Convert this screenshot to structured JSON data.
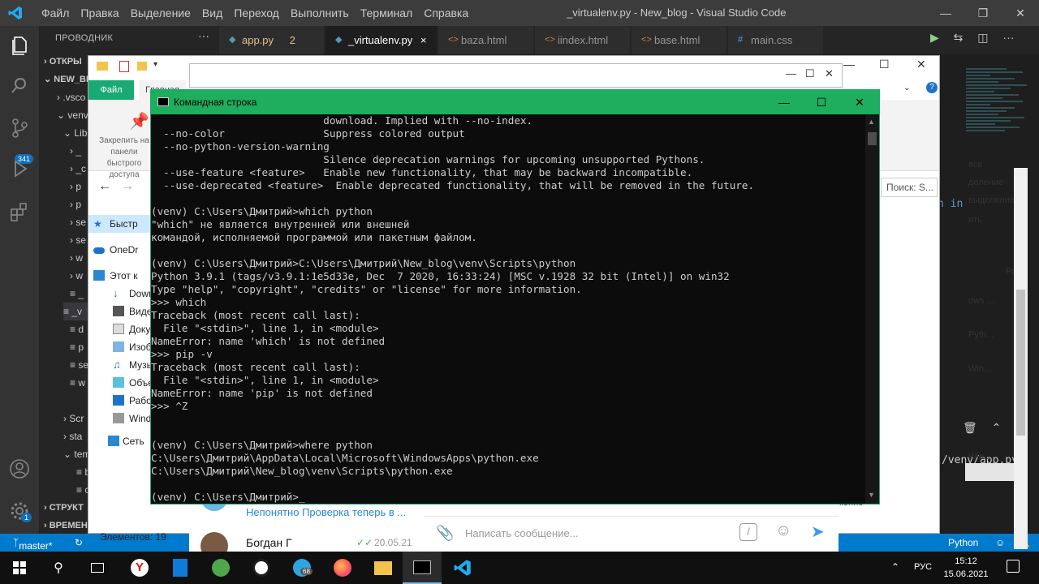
{
  "vscode": {
    "menu": [
      "Файл",
      "Правка",
      "Выделение",
      "Вид",
      "Переход",
      "Выполнить",
      "Терминал",
      "Справка"
    ],
    "window_title": "_virtualenv.py - New_blog - Visual Studio Code",
    "sidebar": {
      "header": "ПРОВОДНИК",
      "more": "···",
      "sections": [
        "ОТКРЫ",
        "NEW_BL"
      ],
      "items": [
        ".vsco",
        "venv",
        "Lib",
        "_",
        "_c",
        "p",
        "p",
        "se",
        "se",
        "w",
        "w",
        "_",
        "_v",
        "d",
        "p",
        "se",
        "w",
        "Scr",
        "sta",
        "tem",
        "b",
        "co"
      ],
      "bottom_sections": [
        "СТРУКТ",
        "ВРЕМЕН"
      ]
    },
    "activity_badges": {
      "source_control": "341",
      "settings": "1"
    },
    "tabs": [
      {
        "label": "app.py",
        "extra": "2"
      },
      {
        "label": "_virtualenv.py",
        "extra": "×"
      },
      {
        "label": "baza.html",
        "extra": ""
      },
      {
        "label": "iindex.html",
        "extra": ""
      },
      {
        "label": "base.html",
        "extra": ""
      },
      {
        "label": "main.css",
        "extra": ""
      }
    ],
    "code_fragment": "n in",
    "path_fragment": "/venv/app.py",
    "status": {
      "branch": "master*",
      "language": "Python"
    }
  },
  "explorer": {
    "tab_file": "Файл",
    "tab_home": "Главная",
    "pin_label": "Закрепить на панели быстрого доступа",
    "nav_items": [
      "Быстр",
      "OneDr",
      "Этот к",
      "Dowr",
      "Виде",
      "Доку",
      "Изоб",
      "Музы",
      "Объе",
      "Рабо",
      "Wind",
      "Сеть"
    ],
    "status": "Элементов: 19",
    "search": "Поиск: S...",
    "right_labels": [
      "все",
      "деление",
      "выделение",
      "ить"
    ],
    "right_items": [
      "Ра",
      "ows ...",
      "Pyth...",
      "Win...",
      "Win..."
    ]
  },
  "telegram": {
    "chat1_text": "Непонятно Проверка теперь в ...",
    "chat2_name": "Богдан Г",
    "chat2_date": "20.05.21",
    "compose_placeholder": "Написать сообщение...",
    "side_text": "кение"
  },
  "cmd": {
    "title": "Командная строка",
    "lines": [
      "                            download. Implied with --no-index.",
      "  --no-color                Suppress colored output",
      "  --no-python-version-warning",
      "                            Silence deprecation warnings for upcoming unsupported Pythons.",
      "  --use-feature <feature>   Enable new functionality, that may be backward incompatible.",
      "  --use-deprecated <feature>  Enable deprecated functionality, that will be removed in the future.",
      "",
      "(venv) C:\\Users\\Дмитрий>which python",
      "\"which\" не является внутренней или внешней",
      "командой, исполняемой программой или пакетным файлом.",
      "",
      "(venv) C:\\Users\\Дмитрий>C:\\Users\\Дмитрий\\New_blog\\venv\\Scripts\\python",
      "Python 3.9.1 (tags/v3.9.1:1e5d33e, Dec  7 2020, 16:33:24) [MSC v.1928 32 bit (Intel)] on win32",
      "Type \"help\", \"copyright\", \"credits\" or \"license\" for more information.",
      ">>> which",
      "Traceback (most recent call last):",
      "  File \"<stdin>\", line 1, in <module>",
      "NameError: name 'which' is not defined",
      ">>> pip -v",
      "Traceback (most recent call last):",
      "  File \"<stdin>\", line 1, in <module>",
      "NameError: name 'pip' is not defined",
      ">>> ^Z",
      "",
      "",
      "(venv) C:\\Users\\Дмитрий>where python",
      "C:\\Users\\Дмитрий\\AppData\\Local\\Microsoft\\WindowsApps\\python.exe",
      "C:\\Users\\Дмитрий\\New_blog\\venv\\Scripts\\python.exe",
      "",
      "(venv) C:\\Users\\Дмитрий>_"
    ]
  },
  "taskbar": {
    "lang": "РУС",
    "time": "15:12",
    "date": "15.06.2021",
    "telegram_badge": "68"
  }
}
